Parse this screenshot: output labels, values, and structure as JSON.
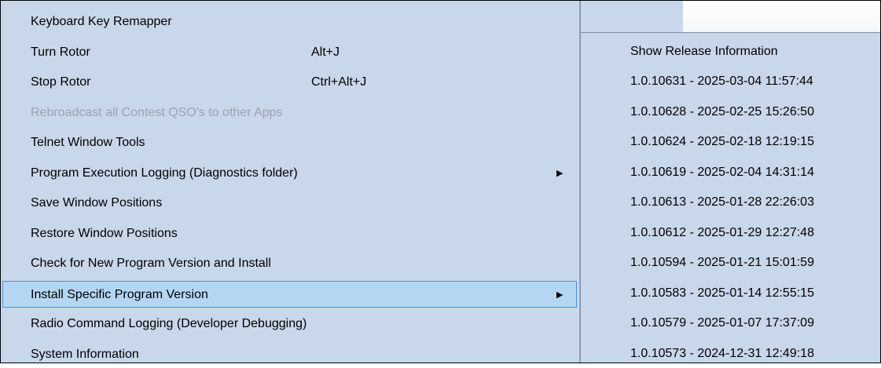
{
  "menu": {
    "items": [
      {
        "label": "Keyboard Key Remapper"
      },
      {
        "label": "Turn Rotor",
        "shortcut": "Alt+J"
      },
      {
        "label": "Stop Rotor",
        "shortcut": "Ctrl+Alt+J"
      },
      {
        "label": "Rebroadcast all Contest QSO's to other Apps",
        "disabled": true
      },
      {
        "label": "Telnet Window Tools"
      },
      {
        "label": "Program Execution Logging (Diagnostics folder)",
        "has_submenu": true
      },
      {
        "label": "Save Window Positions"
      },
      {
        "label": "Restore Window Positions"
      },
      {
        "label": "Check for New Program Version and Install"
      },
      {
        "label": "Install Specific Program Version",
        "has_submenu": true,
        "highlighted": true
      },
      {
        "label": "Radio Command Logging  (Developer Debugging)"
      },
      {
        "label": "System Information"
      }
    ],
    "submenu_arrow": "▶"
  },
  "submenu": {
    "items": [
      {
        "label": "Show Release Information"
      },
      {
        "label": "1.0.10631 - 2025-03-04 11:57:44"
      },
      {
        "label": "1.0.10628 - 2025-02-25 15:26:50"
      },
      {
        "label": "1.0.10624 - 2025-02-18 12:19:15"
      },
      {
        "label": "1.0.10619 - 2025-02-04 14:31:14"
      },
      {
        "label": "1.0.10613 - 2025-01-28 22:26:03"
      },
      {
        "label": "1.0.10612 - 2025-01-29 12:27:48"
      },
      {
        "label": "1.0.10594 - 2025-01-21 15:01:59"
      },
      {
        "label": "1.0.10583 - 2025-01-14 12:55:15"
      },
      {
        "label": "1.0.10579 - 2025-01-07 17:37:09"
      },
      {
        "label": "1.0.10573 - 2024-12-31 12:49:18"
      }
    ]
  },
  "colors": {
    "menu_background": "#c9d7ea",
    "highlight_background": "#b5d6f3",
    "highlight_border": "#4a90d9",
    "disabled_text": "#9aa3b2"
  }
}
